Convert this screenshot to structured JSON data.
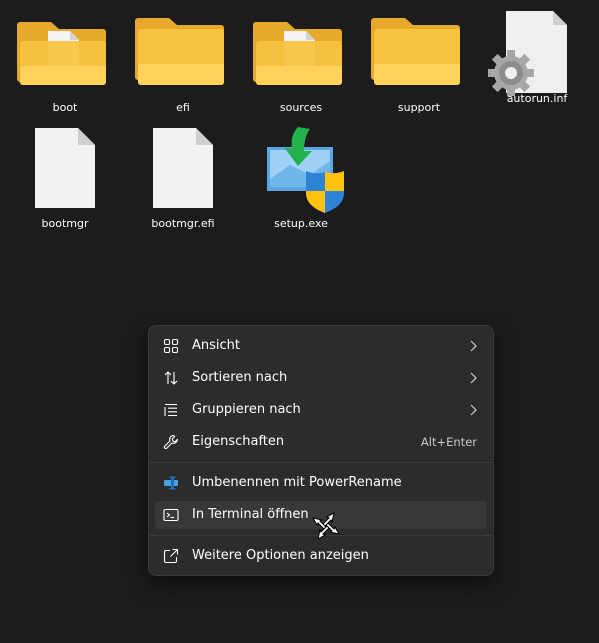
{
  "desktop": {
    "items": [
      {
        "name": "boot",
        "icon": "folder-with-file-icon"
      },
      {
        "name": "efi",
        "icon": "folder-icon"
      },
      {
        "name": "sources",
        "icon": "folder-with-file-icon"
      },
      {
        "name": "support",
        "icon": "folder-icon"
      },
      {
        "name": "autorun.inf",
        "icon": "settings-file-icon"
      },
      {
        "name": "bootmgr",
        "icon": "file-icon"
      },
      {
        "name": "bootmgr.efi",
        "icon": "file-icon"
      },
      {
        "name": "setup.exe",
        "icon": "setup-shield-icon"
      }
    ]
  },
  "context_menu": {
    "items": [
      {
        "label": "Ansicht",
        "icon": "view-grid-icon",
        "submenu": true
      },
      {
        "label": "Sortieren nach",
        "icon": "sort-arrows-icon",
        "submenu": true
      },
      {
        "label": "Gruppieren nach",
        "icon": "group-list-icon",
        "submenu": true
      },
      {
        "label": "Eigenschaften",
        "icon": "wrench-icon",
        "shortcut": "Alt+Enter"
      },
      {
        "label": "Umbenennen mit PowerRename",
        "icon": "powerrename-icon"
      },
      {
        "label": "In Terminal öffnen",
        "icon": "terminal-icon",
        "highlighted": true
      },
      {
        "label": "Weitere Optionen anzeigen",
        "icon": "open-external-icon"
      }
    ]
  },
  "colors": {
    "background": "#1c1c1c",
    "menu_background": "#2c2c2c",
    "menu_highlight": "#383838",
    "folder": "#f7c33f",
    "accent_blue": "#2f83d6"
  }
}
